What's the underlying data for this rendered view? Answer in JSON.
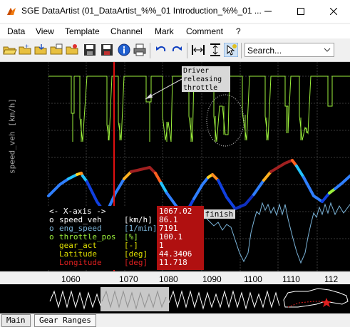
{
  "window": {
    "title": "SGE DataArtist (01_DataArtist_%%_01 Introduction_%%_01 ...",
    "minimize": "—",
    "maximize": "☐",
    "close": "✕"
  },
  "menu": {
    "items": [
      "Data",
      "View",
      "Template",
      "Channel",
      "Mark",
      "Comment",
      "?"
    ]
  },
  "toolbar": {
    "search_placeholder": "Search..."
  },
  "plot": {
    "ylabel": "speed_veh [km/h]",
    "annotation": "Driver\nreleasing\nthrottle",
    "annotation_lines": [
      "Driver",
      "releasing",
      "throttle"
    ],
    "lap_label": "Lap finish",
    "x_ticks": [
      "1060",
      "1070",
      "1080",
      "1090",
      "1100",
      "1110",
      "112"
    ],
    "legend": {
      "header": "<- X-axis ->",
      "header_value": "1067.02",
      "rows": [
        {
          "marker": "o",
          "name": "speed_veh",
          "unit": "[km/h]",
          "value": "86.1",
          "color": "#ffffff"
        },
        {
          "marker": "o",
          "name": "eng_speed",
          "unit": "[1/min]",
          "value": "7191",
          "color": "#7ab3d8"
        },
        {
          "marker": "o",
          "name": "throttle_pos",
          "unit": "[%]",
          "value": "100.1",
          "color": "#9cf03c"
        },
        {
          "marker": " ",
          "name": "gear_act",
          "unit": "[-]",
          "value": "1",
          "color": "#e0e000"
        },
        {
          "marker": " ",
          "name": "Latitude",
          "unit": "[deg]",
          "value": "44.3406",
          "color": "#e0e000"
        },
        {
          "marker": " ",
          "name": "Longitude",
          "unit": "[deg]",
          "value": "11.718",
          "color": "#e02020"
        }
      ]
    }
  },
  "tabs": [
    "Main",
    "Gear Ranges"
  ],
  "colors": {
    "throttle": "#9cf03c",
    "rpm": "#7ab3d8",
    "cursor": "#e01010",
    "legend_value_bg": "#b01010"
  }
}
